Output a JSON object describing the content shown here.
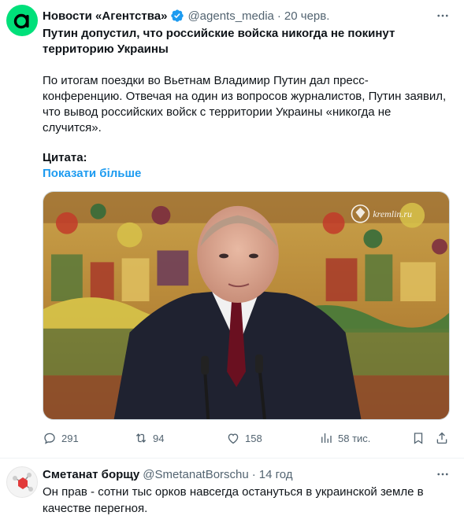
{
  "tweet": {
    "author_name": "Новости «Агентства»",
    "handle": "@agents_media",
    "separator": "·",
    "date": "20 черв.",
    "headline": "Путин допустил, что российские войска никогда не покинут территорию Украины",
    "body": "По итогам поездки во Вьетнам Владимир Путин дал пресс-конференцию. Отвечая на один из вопросов журналистов, Путин заявил, что вывод российских войск с территории Украины «никогда не случится».",
    "quote_label": "Цитата:",
    "show_more": "Показати більше",
    "media": {
      "watermark": "kremlin.ru"
    },
    "actions": {
      "replies": "291",
      "reposts": "94",
      "likes": "158",
      "views": "58 тис."
    },
    "icons": [
      "verified-badge-icon",
      "more-icon",
      "reply-icon",
      "repost-icon",
      "like-icon",
      "views-icon",
      "bookmark-icon",
      "share-icon"
    ],
    "colors": {
      "brand": "#00e07a",
      "link": "#1d9bf0",
      "muted": "#536471",
      "text": "#0f1419"
    }
  },
  "reply": {
    "author_name": "Сметанат борщу",
    "handle": "@SmetanatBorschu",
    "separator": "·",
    "date": "14 год",
    "text": "Он прав - сотни тыс орков навсегда остануться в украинской земле в качестве перегноя."
  }
}
